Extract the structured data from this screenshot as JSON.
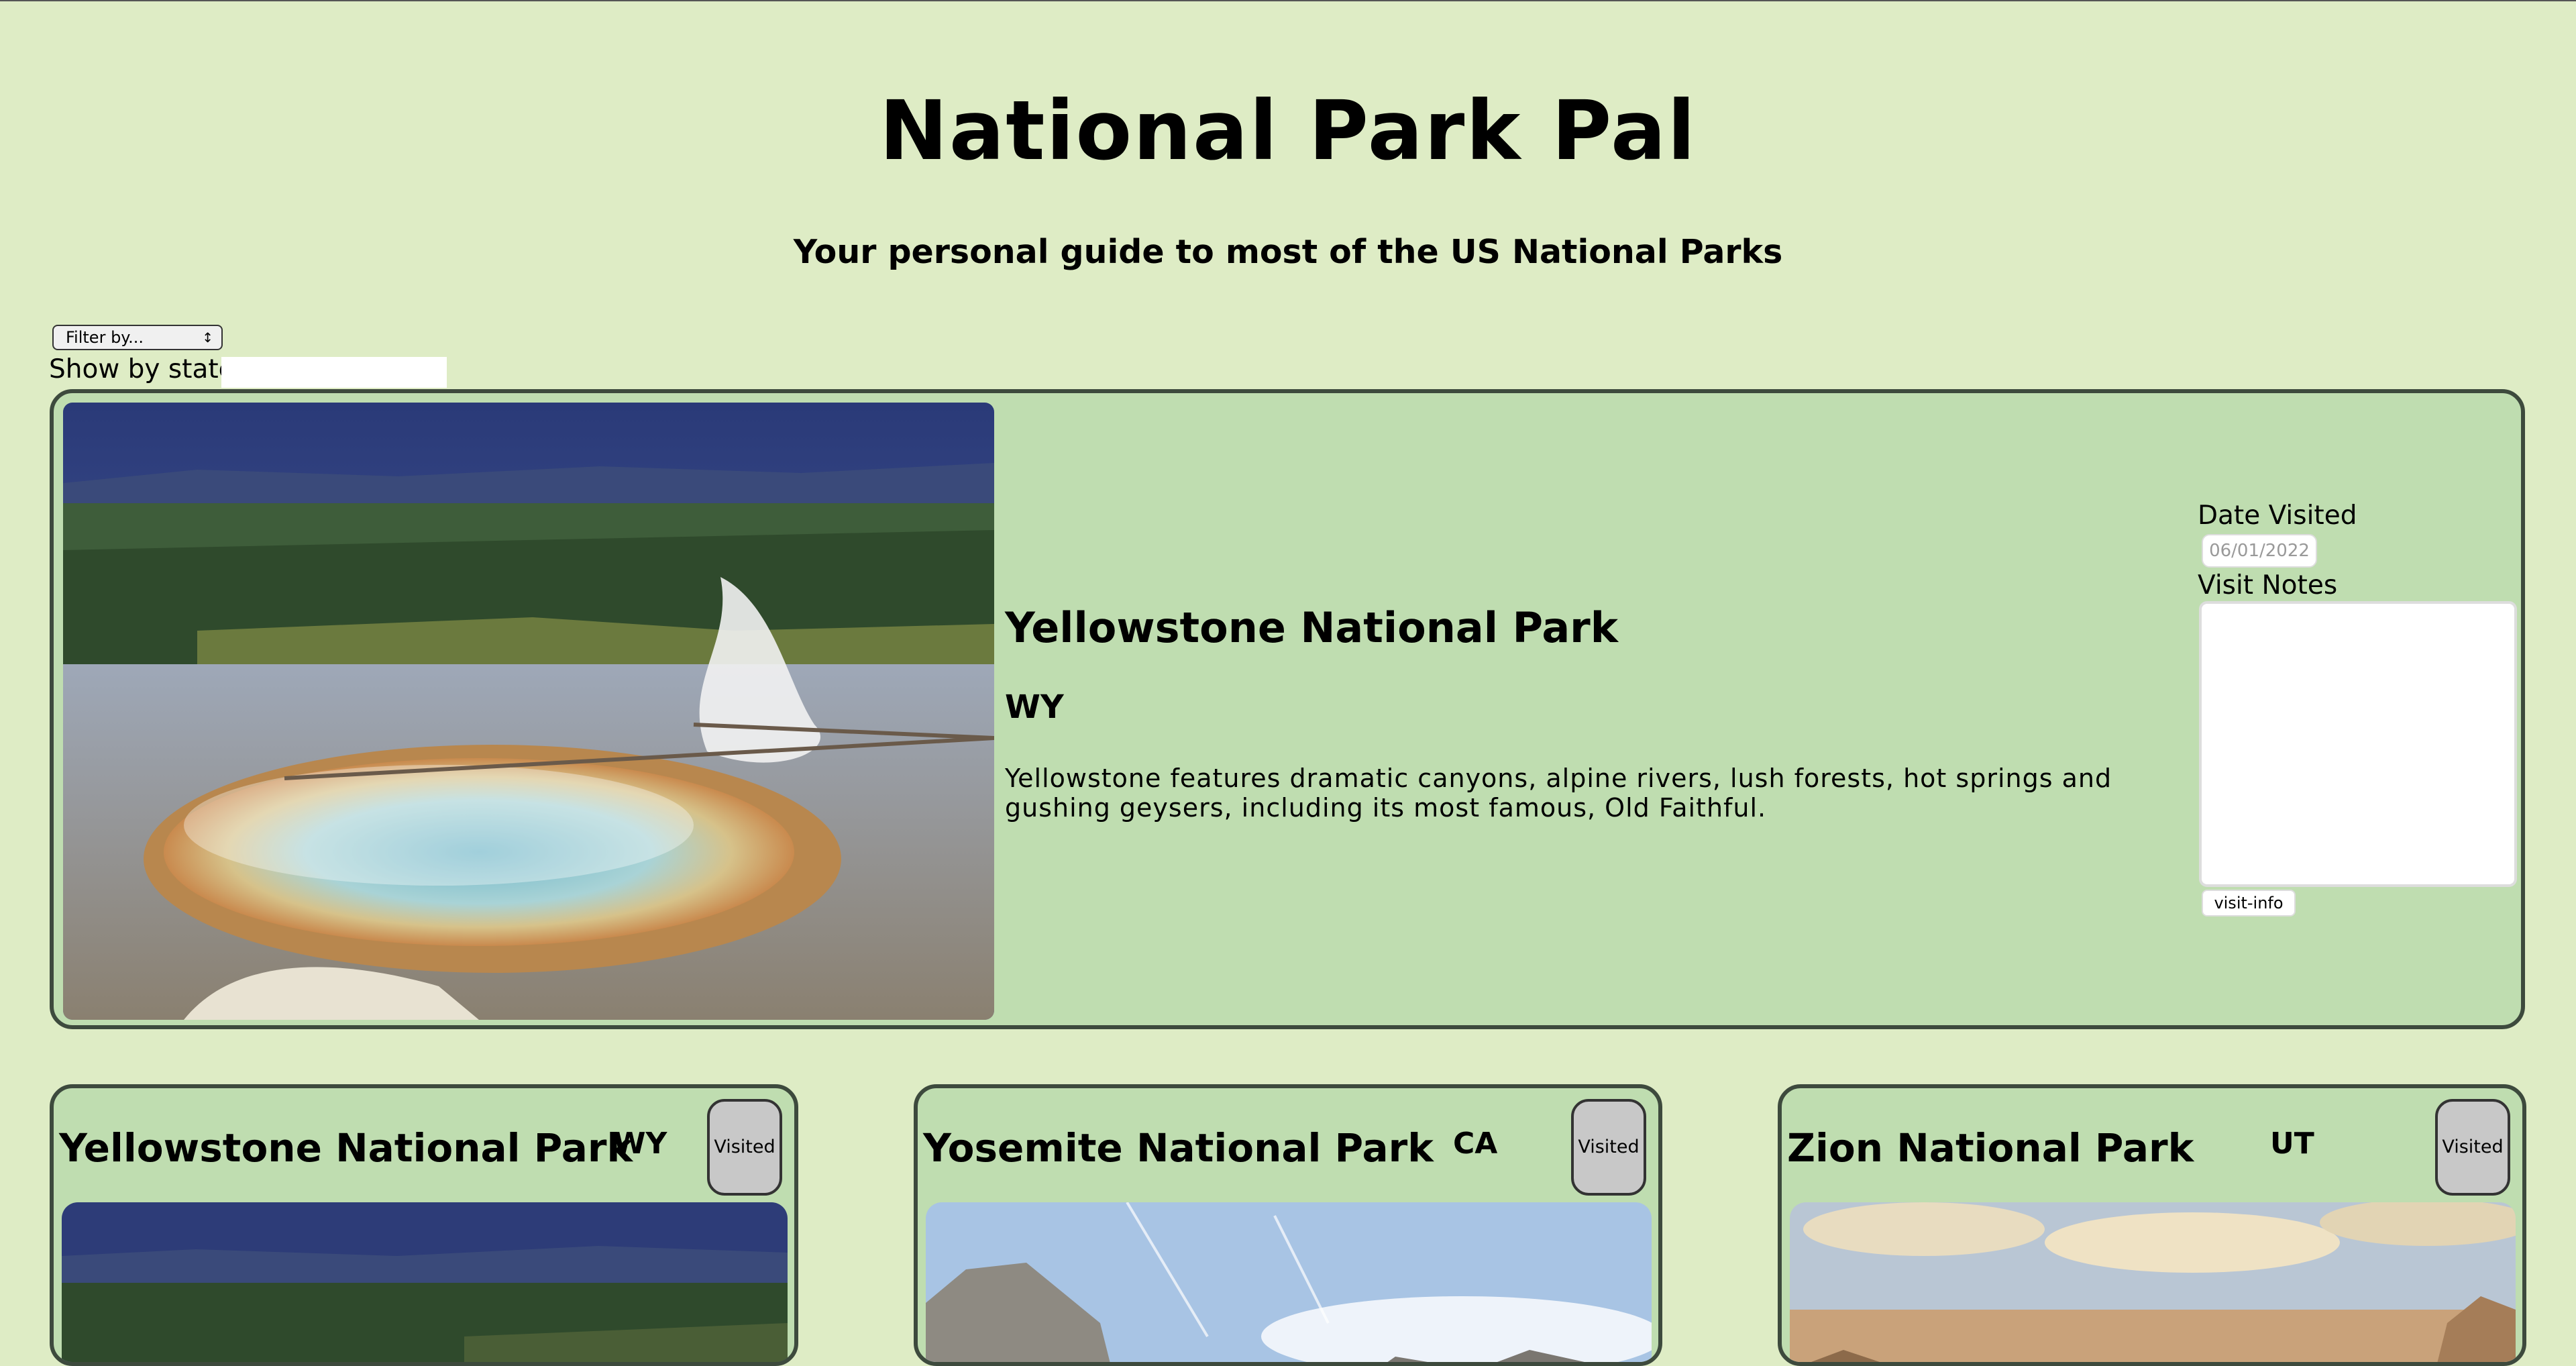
{
  "header": {
    "title": "National Park Pal",
    "subtitle": "Your personal guide to most of the US National Parks"
  },
  "controls": {
    "filter_label": "Filter by...",
    "state_label": "Show by state",
    "state_value": ""
  },
  "featured": {
    "name": "Yellowstone National Park",
    "state": "WY",
    "description": "Yellowstone features dramatic canyons, alpine rivers, lush forests, hot springs and gushing geysers, including its most famous, Old Faithful.",
    "date_label": "Date Visited",
    "date_value": "06/01/2022",
    "notes_label": "Visit Notes",
    "notes_value": "",
    "button_label": "visit-info"
  },
  "parks": [
    {
      "name": "Yellowstone National Park",
      "state": "WY",
      "button": "Visited"
    },
    {
      "name": "Yosemite National Park",
      "state": "CA",
      "button": "Visited"
    },
    {
      "name": "Zion National Park",
      "state": "UT",
      "button": "Visited"
    }
  ],
  "colors": {
    "page_background": "#deecc5",
    "card_background": "#bfddb0",
    "card_border": "#3d4a3d",
    "button_gray": "#c8c8c8"
  }
}
